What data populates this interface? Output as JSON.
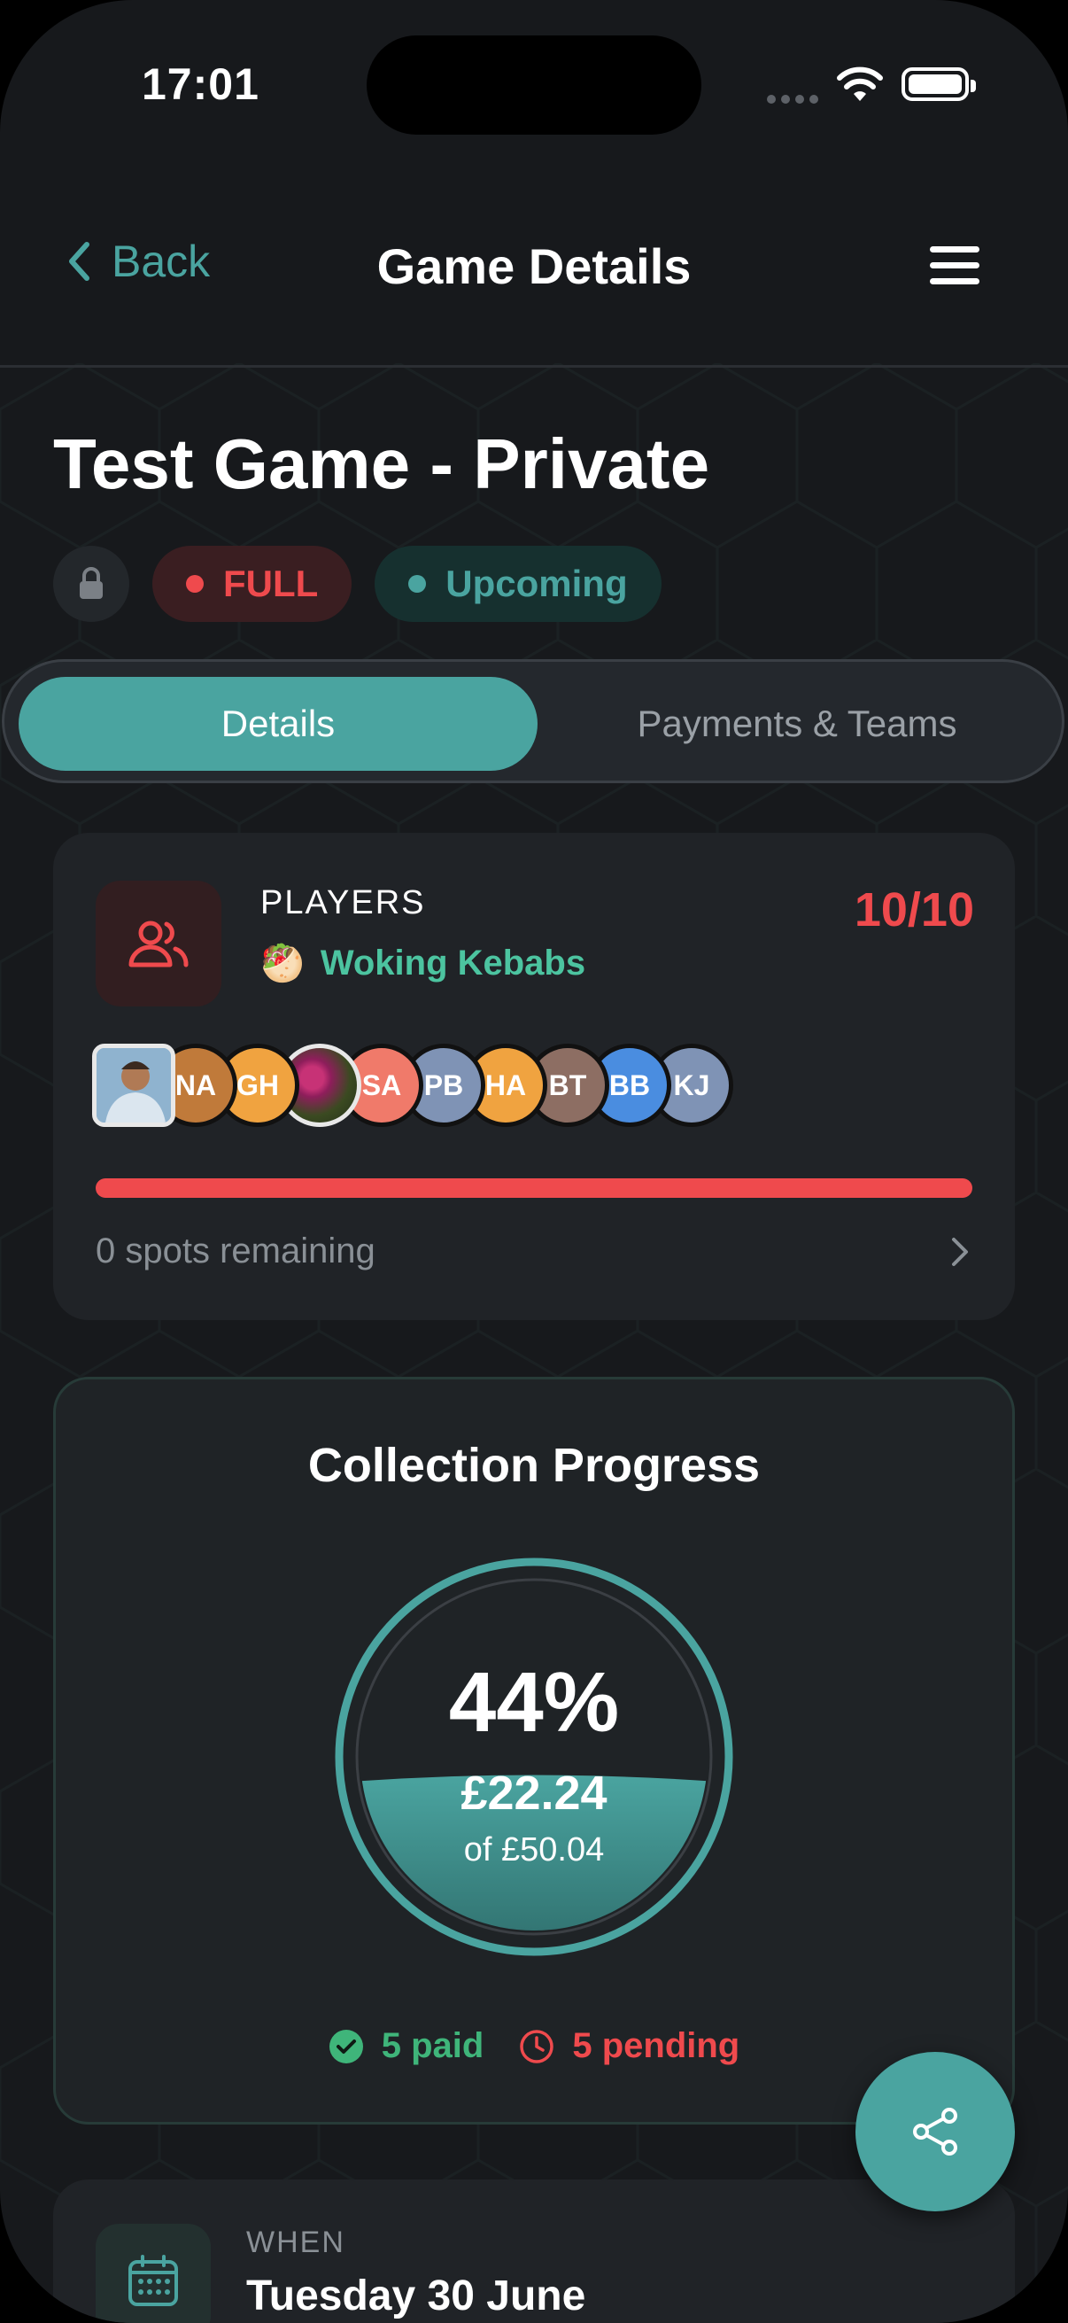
{
  "status_bar": {
    "time": "17:01"
  },
  "nav": {
    "back_label": "Back",
    "title": "Game Details"
  },
  "game": {
    "title": "Test Game - Private",
    "badges": {
      "full": "FULL",
      "upcoming": "Upcoming"
    }
  },
  "tabs": [
    {
      "label": "Details",
      "active": true
    },
    {
      "label": "Payments & Teams",
      "active": false
    }
  ],
  "players": {
    "label": "PLAYERS",
    "group_emoji": "🥙",
    "group_name": "Woking Kebabs",
    "count": "10/10",
    "fill_fraction": 1.0,
    "avatars": [
      {
        "initials": "",
        "type": "photo"
      },
      {
        "initials": "NA",
        "color": "#c07a3a"
      },
      {
        "initials": "GH",
        "color": "#f0a340"
      },
      {
        "initials": "",
        "type": "flower"
      },
      {
        "initials": "SA",
        "color": "#f07a6a"
      },
      {
        "initials": "PB",
        "color": "#7f93b5"
      },
      {
        "initials": "HA",
        "color": "#f0a340"
      },
      {
        "initials": "BT",
        "color": "#8d6e63"
      },
      {
        "initials": "BB",
        "color": "#4a8de0"
      },
      {
        "initials": "KJ",
        "color": "#7f93b5"
      }
    ],
    "spots_remaining": "0 spots remaining"
  },
  "collection": {
    "title": "Collection Progress",
    "percent_label": "44%",
    "fraction": 0.44,
    "amount": "£22.24",
    "of_total": "of £50.04",
    "paid_label": "5 paid",
    "pending_label": "5 pending"
  },
  "when": {
    "label": "WHEN",
    "value": "Tuesday 30 June"
  },
  "colors": {
    "accent": "#4aa4a0",
    "danger": "#ef4a4d",
    "success": "#3fb57a",
    "background": "#17191c",
    "card": "#202327"
  }
}
